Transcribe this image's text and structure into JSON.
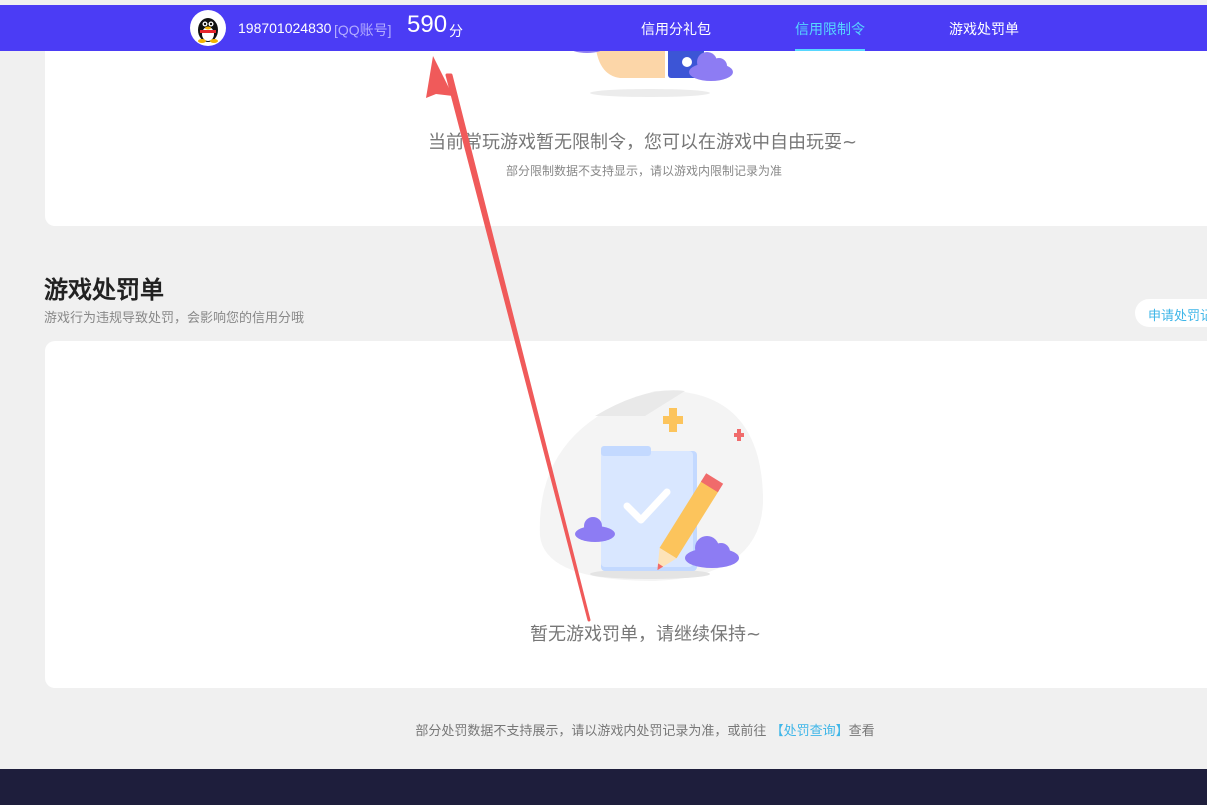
{
  "header": {
    "account_number": "198701024830",
    "account_type": "[QQ账号]",
    "score": "590",
    "score_unit": "分",
    "nav": [
      {
        "label": "信用分礼包"
      },
      {
        "label": "信用限制令"
      },
      {
        "label": "游戏处罚单"
      }
    ],
    "active_tab": 1
  },
  "restriction": {
    "empty_text": "当前常玩游戏暂无限制令，您可以在游戏中自由玩耍~",
    "note": "部分限制数据不支持显示，请以游戏内限制记录为准"
  },
  "penalty": {
    "title": "游戏处罚单",
    "desc": "游戏行为违规导致处罚，会影响您的信用分哦",
    "apply_button": "申请处罚记",
    "empty_text": "暂无游戏罚单，请继续保持~"
  },
  "footer": {
    "note_prefix": "部分处罚数据不支持展示，请以游戏内处罚记录为准，或前往",
    "link_text": "【处罚查询】",
    "note_suffix": "查看"
  },
  "colors": {
    "nav_bg": "#4b3cf5",
    "accent": "#57d7ff",
    "link": "#3fb6e8",
    "annotation_arrow": "#f05a5a"
  },
  "icons": [
    "qq-penguin-icon",
    "cloud-icon",
    "sparkle-icon",
    "checkmark-icon",
    "pencil-icon"
  ]
}
